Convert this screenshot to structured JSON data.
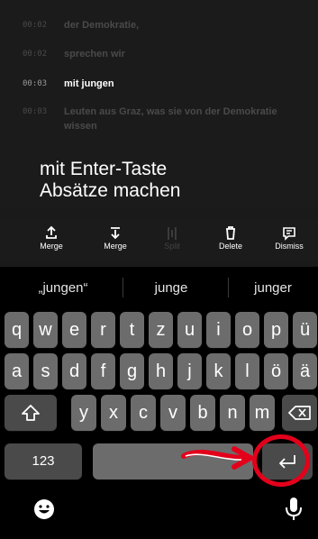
{
  "transcript": {
    "segments": [
      {
        "time": "00:02",
        "text": "der Demokratie,",
        "state": "dim"
      },
      {
        "time": "00:02",
        "text": "sprechen wir",
        "state": "dim"
      },
      {
        "time": "00:03",
        "text": "mit jungen",
        "state": "active"
      },
      {
        "time": "00:03",
        "text": "Leuten aus Graz, was sie von der Demokratie wissen",
        "state": "dim"
      }
    ]
  },
  "annotation": {
    "line1": "mit Enter-Taste",
    "line2": "Absätze machen"
  },
  "toolbar": {
    "merge_up": "Merge",
    "merge_down": "Merge",
    "split": "Split",
    "delete": "Delete",
    "dismiss": "Dismiss"
  },
  "suggestions": [
    "„jungen“",
    "junge",
    "junger"
  ],
  "keyboard": {
    "row1": [
      "q",
      "w",
      "e",
      "r",
      "t",
      "z",
      "u",
      "i",
      "o",
      "p",
      "ü"
    ],
    "row2": [
      "a",
      "s",
      "d",
      "f",
      "g",
      "h",
      "j",
      "k",
      "l",
      "ö",
      "ä"
    ],
    "row3": [
      "y",
      "x",
      "c",
      "v",
      "b",
      "n",
      "m"
    ],
    "numbers_label": "123"
  },
  "colors": {
    "highlight_red": "#e3001b",
    "key": "#6c6c6c",
    "key_dark": "#4a4a4a"
  },
  "icons": {
    "merge_up": "upload-arrow-icon",
    "merge_down": "download-arrow-icon",
    "split": "split-icon",
    "delete": "trash-icon",
    "dismiss": "chat-dismiss-icon",
    "shift": "shift-icon",
    "backspace": "backspace-icon",
    "return": "return-icon",
    "emoji": "emoji-icon",
    "mic": "microphone-icon"
  }
}
